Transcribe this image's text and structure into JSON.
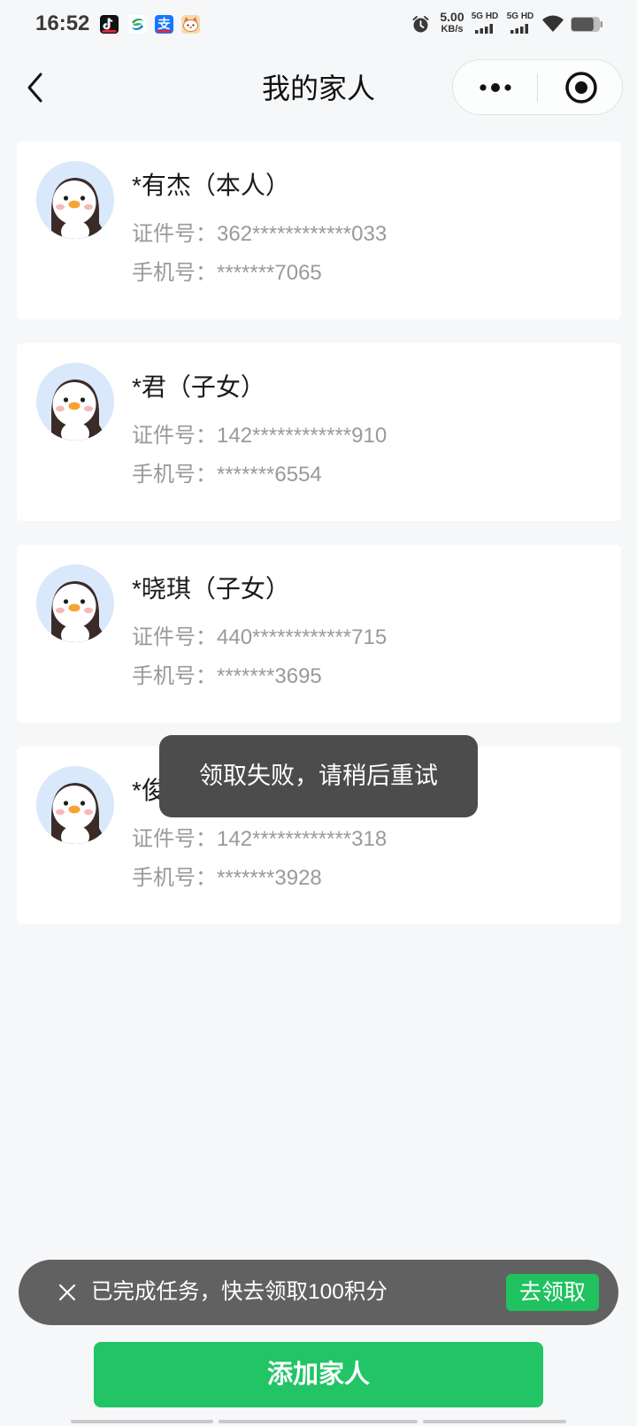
{
  "status_bar": {
    "time": "16:52",
    "app_icons": [
      "tiktok-icon",
      "china-mobile-icon",
      "alipay-icon",
      "cat-app-icon"
    ],
    "alarm_icon": "alarm-icon",
    "net_speed": {
      "value": "5.00",
      "unit": "KB/s"
    },
    "sim1": {
      "label": "5G HD",
      "icon": "signal-icon"
    },
    "sim2": {
      "label": "5G HD",
      "icon": "signal-icon"
    },
    "wifi_icon": "wifi-icon",
    "battery": {
      "icon": "battery-icon",
      "level": 0.8
    }
  },
  "header": {
    "back_icon": "chevron-left-icon",
    "title": "我的家人",
    "capsule": {
      "more_icon": "more-icon",
      "close_icon": "close-miniprogram-icon"
    }
  },
  "members": [
    {
      "avatar": "penguin-avatar",
      "name": "*有杰（本人）",
      "id_label": "证件号：",
      "id_number": "362************033",
      "phone_label": "手机号：",
      "phone_number": "*******7065"
    },
    {
      "avatar": "penguin-avatar",
      "name": "*君（子女）",
      "id_label": "证件号：",
      "id_number": "142************910",
      "phone_label": "手机号：",
      "phone_number": "*******6554"
    },
    {
      "avatar": "penguin-avatar",
      "name": "*晓琪（子女）",
      "id_label": "证件号：",
      "id_number": "440************715",
      "phone_label": "手机号：",
      "phone_number": "*******3695"
    },
    {
      "avatar": "penguin-avatar",
      "name": "*俊",
      "id_label": "证件号：",
      "id_number": "142************318",
      "phone_label": "手机号：",
      "phone_number": "*******3928"
    }
  ],
  "toast": {
    "message": "领取失败，请稍后重试"
  },
  "task_banner": {
    "close_icon": "close-icon",
    "message": "已完成任务，快去领取100积分",
    "action_label": "去领取"
  },
  "add_button": {
    "label": "添加家人"
  },
  "colors": {
    "background": "#f6f7f9",
    "card": "#ffffff",
    "primary_green": "#22c466",
    "action_green": "#1fc25f",
    "toast_bg": "#4c4c4c",
    "banner_bg": "#616161",
    "primary_text": "#1a1a1a",
    "secondary_text": "#9a9a9a",
    "avatar_bg": "#d9e8fa"
  }
}
